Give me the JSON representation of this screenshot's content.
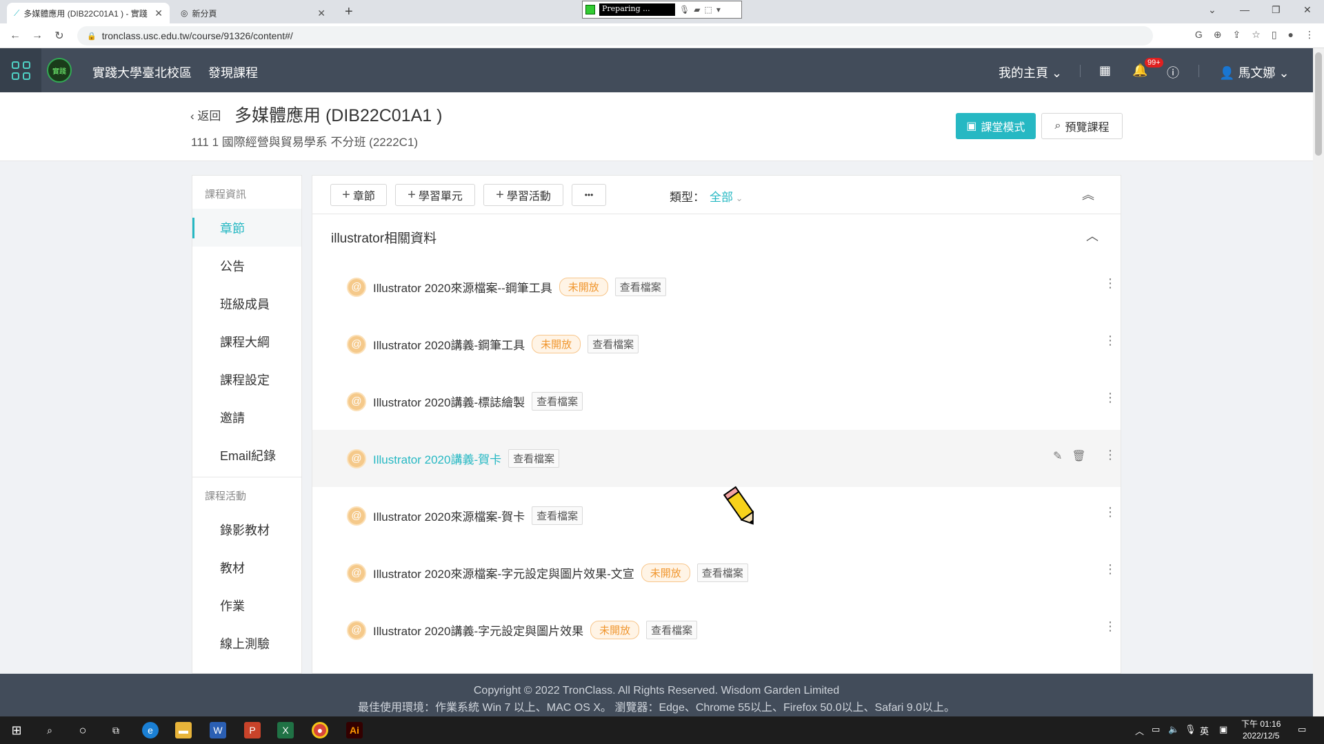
{
  "browser": {
    "tabs": [
      {
        "title": "多媒體應用 (DIB22C01A1 ) - 實踐",
        "close": "✕"
      },
      {
        "title": "新分頁",
        "close": "✕"
      }
    ],
    "new_tab": "+",
    "recorder_status": "Preparing ...",
    "url": "tronclass.usc.edu.tw/course/91326/content#/"
  },
  "header": {
    "nav": [
      "實踐大學臺北校區",
      "發現課程"
    ],
    "my_home": "我的主頁",
    "notification_count": "99+",
    "user_name": "馬文娜"
  },
  "course": {
    "back": "返回",
    "title": "多媒體應用 (DIB22C01A1 )",
    "subtitle": "111 1 國際經營與貿易學系 不分班 (2222C1)",
    "class_mode_button": "課堂模式",
    "preview_button": "預覽課程"
  },
  "sidebar": {
    "group1": "課程資訊",
    "items1": [
      "章節",
      "公告",
      "班級成員",
      "課程大綱",
      "課程設定",
      "邀請",
      "Email紀錄"
    ],
    "group2": "課程活動",
    "items2": [
      "錄影教材",
      "教材",
      "作業",
      "線上測驗"
    ]
  },
  "toolbar": {
    "add_chapter": "章節",
    "add_unit": "學習單元",
    "add_activity": "學習活動",
    "more": "•••",
    "type_label": "類型：",
    "type_value": "全部"
  },
  "section": {
    "title": "illustrator相關資料",
    "items": [
      {
        "title": "Illustrator 2020來源檔案--鋼筆工具",
        "status": "未開放",
        "view": "查看檔案"
      },
      {
        "title": "Illustrator 2020講義-鋼筆工具",
        "status": "未開放",
        "view": "查看檔案"
      },
      {
        "title": "Illustrator 2020講義-標誌繪製",
        "status": "",
        "view": "查看檔案"
      },
      {
        "title": "Illustrator 2020講義-賀卡",
        "status": "",
        "view": "查看檔案"
      },
      {
        "title": "Illustrator 2020來源檔案-賀卡",
        "status": "",
        "view": "查看檔案"
      },
      {
        "title": "Illustrator 2020來源檔案-字元設定與圖片效果-文宣",
        "status": "未開放",
        "view": "查看檔案"
      },
      {
        "title": "Illustrator 2020講義-字元設定與圖片效果",
        "status": "未開放",
        "view": "查看檔案"
      }
    ]
  },
  "footer": {
    "line1": "Copyright © 2022 TronClass. All Rights Reserved. Wisdom Garden Limited",
    "line2": "最佳使用環境：作業系統 Win 7 以上、MAC OS X。 瀏覽器：Edge、Chrome 55以上、Firefox 50.0以上、Safari 9.0以上。"
  },
  "taskbar": {
    "ime": "英",
    "time": "下午 01:16",
    "date": "2022/12/5"
  },
  "colors": {
    "accent": "#26b8c3",
    "header_bg": "#424c5a",
    "closed_tag": "#f0962e"
  }
}
